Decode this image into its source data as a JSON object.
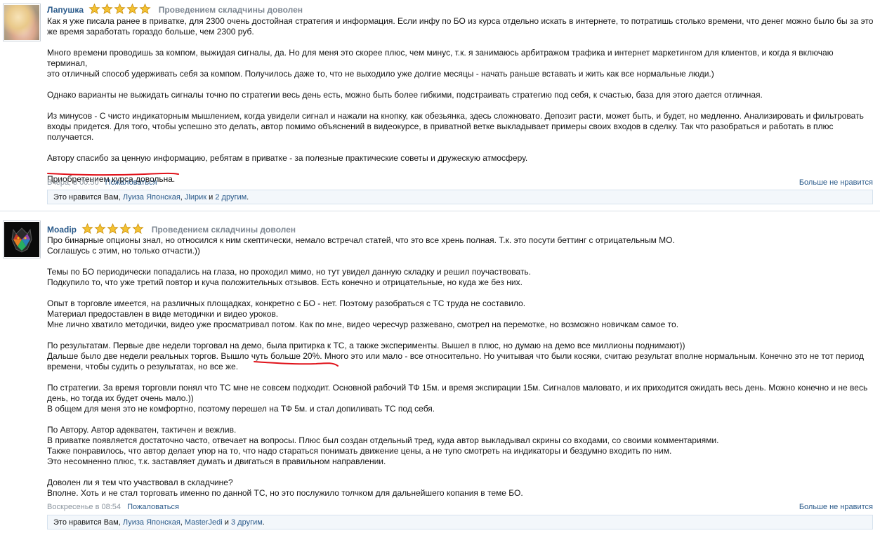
{
  "posts": [
    {
      "username": "Лапушка",
      "verdict": "Проведением складчины доволен",
      "lines": [
        "Как я уже писала ранее в приватке, для 2300 очень достойная стратегия и информация. Если инфу по БО из курса отдельно искать в интернете, то потратишь столько времени, что денег можно было бы за это",
        "же время заработать гораздо больше, чем 2300 руб.",
        "",
        "Много времени проводишь за компом, выжидая сигналы, да. Но для меня это скорее плюс, чем минус, т.к. я занимаюсь арбитражом трафика и интернет маркетингом для клиентов, и когда я включаю терминал,",
        "это отличный способ удерживать себя за компом. Получилось даже то, что не выходило уже долгие месяцы - начать раньше вставать и жить как все нормальные люди.)",
        "",
        "Однако варианты не выжидать сигналы точно по стратегии весь день есть, можно быть более гибкими, подстраивать стратегию под себя, к счастью, база для этого дается отличная.",
        "",
        "Из минусов - С чисто индикаторным мышлением, когда увидели сигнал и нажали на кнопку, как обезьянка, здесь сложновато. Депозит расти, может быть, и будет, но медленно. Анализировать и фильтровать",
        "входы придется. Для того, чтобы успешно это делать, автор помимо объяснений в видеокурсе, в приватной ветке выкладывает примеры своих входов в сделку. Так что разобраться и работать в плюс",
        "получается.",
        "",
        "Автору спасибо за ценную информацию, ребятам в приватке - за полезные практические советы и дружескую атмосферу.",
        "",
        "Приобретением курса довольна."
      ],
      "time": "Вчера, в 00:50",
      "report": "Пожаловаться",
      "dislike": "Больше не нравится",
      "likes_prefix": "Это нравится Вам, ",
      "liker1": "Луиза Японская",
      "sep": ", ",
      "liker2": "Jlирик",
      "and": " и ",
      "others": "2 другим",
      "end": "."
    },
    {
      "username": "Moadip",
      "verdict": "Проведением складчины доволен",
      "lines": [
        "Про бинарные опционы знал, но относился к ним скептически, немало встречал статей, что это все хрень полная. Т.к. это посути беттинг с отрицательным МО.",
        "Соглашусь с этим, но только отчасти.))",
        "",
        "Темы по БО периодически попадались на глаза, но проходил мимо, но тут увидел данную складку и решил поучаствовать.",
        "Подкупило то, что уже третий повтор и куча положительных отзывов. Есть конечно и отрицательные, но куда же без них.",
        "",
        "Опыт в торговле имеется, на различных площадках, конкретно с БО - нет. Поэтому разобраться с ТС труда не составило.",
        "Материал предоставлен в виде методички и видео уроков.",
        "Мне лично хватило методички, видео уже просматривал потом. Как по мне, видео чересчур разжевано, смотрел на перемотке, но возможно новичкам самое то.",
        "",
        "По результатам. Первые две недели торговал на демо, была притирка к ТС, а также эксперименты. Вышел в плюс, но думаю на демо все миллионы поднимают))",
        "Дальше было две недели реальных торгов. Вышло чуть больше 20%. Много это или мало - все относительно. Но учитывая что были косяки, считаю результат вполне нормальным. Конечно это не тот период",
        "времени, чтобы судить о результатах, но все же.",
        "",
        "По стратегии. За время торговли понял что ТС мне не совсем подходит. Основной рабочий ТФ 15м. и время экспирации 15м. Сигналов маловато, и их приходится ожидать весь день. Можно конечно и не весь",
        "день, но тогда их будет очень мало.))",
        "В общем для меня это не комфортно, поэтому перешел на ТФ 5м. и стал допиливать ТС под себя.",
        "",
        "По Автору. Автор адекватен, тактичен и вежлив.",
        "В приватке появляется достаточно часто, отвечает на вопросы. Плюс был создан отдельный тред, куда автор выкладывал скрины со входами, со своими комментариями.",
        "Также понравилось, что автор делает упор на то, что надо стараться понимать движение цены, а не тупо смотреть на индикаторы и бездумно входить по ним.",
        "Это несомненно плюс, т.к. заставляет думать и двигаться в правильном направлении.",
        "",
        "Доволен ли я тем что участвовал в складчине?",
        "Вполне. Хоть и не стал торговать именно по данной ТС, но это послужило толчком для дальнейшего копания в теме БО."
      ],
      "time": "Воскресенье в 08:54",
      "report": "Пожаловаться",
      "dislike": "Больше не нравится",
      "likes_prefix": "Это нравится Вам, ",
      "liker1": "Луиза Японская",
      "sep": ", ",
      "liker2": "MasterJedi",
      "and": " и ",
      "others": "3 другим",
      "end": "."
    }
  ],
  "icons": {
    "star": "star-icon",
    "avatar": "avatar"
  },
  "colors": {
    "link": "#2a5a8a",
    "star": "#f2b82a",
    "annotation": "#e0121a"
  }
}
